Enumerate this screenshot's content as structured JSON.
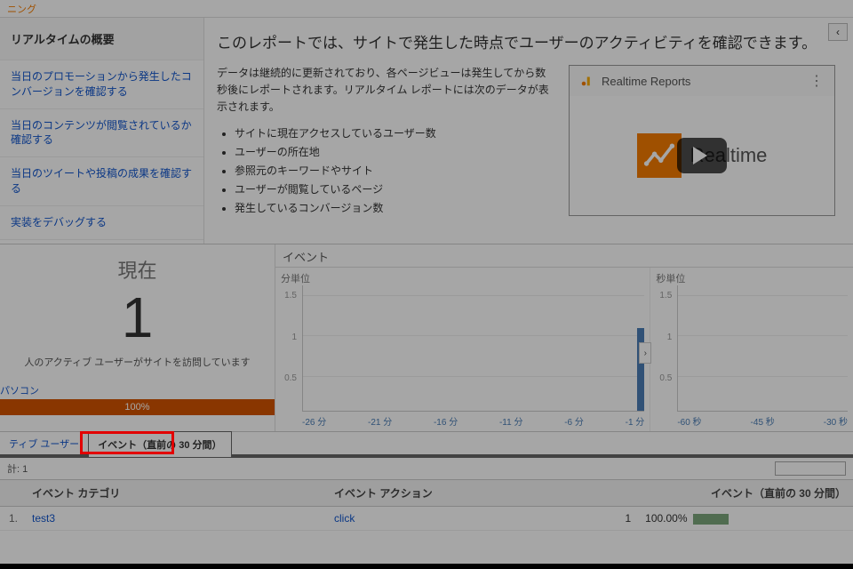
{
  "topbar": {
    "crumb": "ニング"
  },
  "sidebar": {
    "header": "リアルタイムの概要",
    "links": [
      "当日のプロモーションから発生したコンバージョンを確認する",
      "当日のコンテンツが閲覧されているか確認する",
      "当日のツイートや投稿の成果を確認する",
      "実装をデバッグする"
    ]
  },
  "intro": {
    "headline": "このレポートでは、サイトで発生した時点でユーザーのアクティビティを確認できます。",
    "para": "データは継続的に更新されており、各ページビューは発生してから数秒後にレポートされます。リアルタイム レポートには次のデータが表示されます。",
    "bullets": [
      "サイトに現在アクセスしているユーザー数",
      "ユーザーの所在地",
      "参照元のキーワードやサイト",
      "ユーザーが閲覧しているページ",
      "発生しているコンバージョン数"
    ],
    "video_title": "Realtime Reports",
    "video_brand": "Realtime",
    "back_glyph": "‹"
  },
  "current": {
    "label": "現在",
    "value": "1",
    "sub": "人のアクティブ ユーザーがサイトを訪問しています",
    "device_label": "パソコン",
    "device_pct": "100%"
  },
  "charts": {
    "title": "イベント",
    "minute_label": "分単位",
    "second_label": "秒単位",
    "expand_glyph": "›"
  },
  "chart_data": [
    {
      "type": "bar",
      "title": "分単位",
      "xlabel": "",
      "ylabel": "",
      "ylim": [
        0,
        1.5
      ],
      "yticks": [
        0.5,
        1.0,
        1.5
      ],
      "categories": [
        "-26 分",
        "-21 分",
        "-16 分",
        "-11 分",
        "-6 分",
        "-1 分"
      ],
      "values": [
        0,
        0,
        0,
        0,
        0,
        1
      ]
    },
    {
      "type": "bar",
      "title": "秒単位",
      "xlabel": "",
      "ylabel": "",
      "ylim": [
        0,
        1.5
      ],
      "yticks": [
        0.5,
        1,
        1.5
      ],
      "categories": [
        "-60 秒",
        "-45 秒",
        "-30 秒"
      ],
      "values": [
        0,
        0,
        0
      ]
    }
  ],
  "tabs": {
    "left_tab": "ティブ ユーザー",
    "active_tab": "イベント（直前の 30 分間）",
    "count_prefix": "計:",
    "count_value": "1"
  },
  "table": {
    "headers": {
      "rn": "",
      "category": "イベント カテゴリ",
      "action": "イベント アクション",
      "count": "イベント（直前の 30 分間）",
      "pct": ""
    },
    "rows": [
      {
        "n": "1.",
        "category": "test3",
        "action": "click",
        "count": "1",
        "pct": "100.00%"
      }
    ]
  }
}
